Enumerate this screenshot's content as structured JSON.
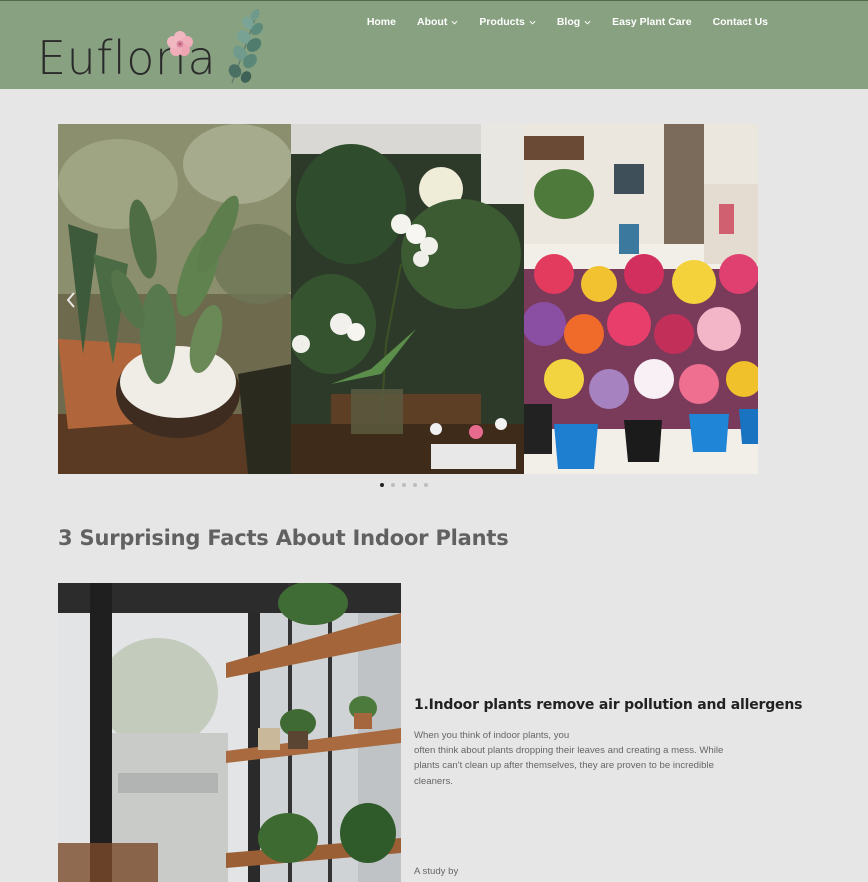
{
  "brand": {
    "name": "Eufloria"
  },
  "nav": {
    "items": [
      {
        "label": "Home",
        "has_dropdown": false
      },
      {
        "label": "About",
        "has_dropdown": true
      },
      {
        "label": "Products",
        "has_dropdown": true
      },
      {
        "label": "Blog",
        "has_dropdown": true
      },
      {
        "label": "Easy Plant Care",
        "has_dropdown": false
      },
      {
        "label": "Contact Us",
        "has_dropdown": false
      }
    ]
  },
  "slider": {
    "slides": [
      {
        "subject": "cactus-in-pot"
      },
      {
        "subject": "white-orchids-and-plants"
      },
      {
        "subject": "flower-market"
      }
    ],
    "dots_total": 5,
    "active_dot": 1
  },
  "section": {
    "title": "3 Surprising Facts About Indoor Plants"
  },
  "article": {
    "heading": "1.Indoor plants remove air pollution and allergens",
    "body_lines": [
      "When you think of indoor plants, you",
      "often think about plants dropping their leaves and creating a mess. While plants can't clean up after themselves, they are proven to be incredible cleaners."
    ],
    "more": "A study by"
  },
  "colors": {
    "header_bg": "#88a281",
    "page_bg": "#e6e6e6",
    "nav_text": "#ffffff",
    "title_text": "#616161"
  }
}
